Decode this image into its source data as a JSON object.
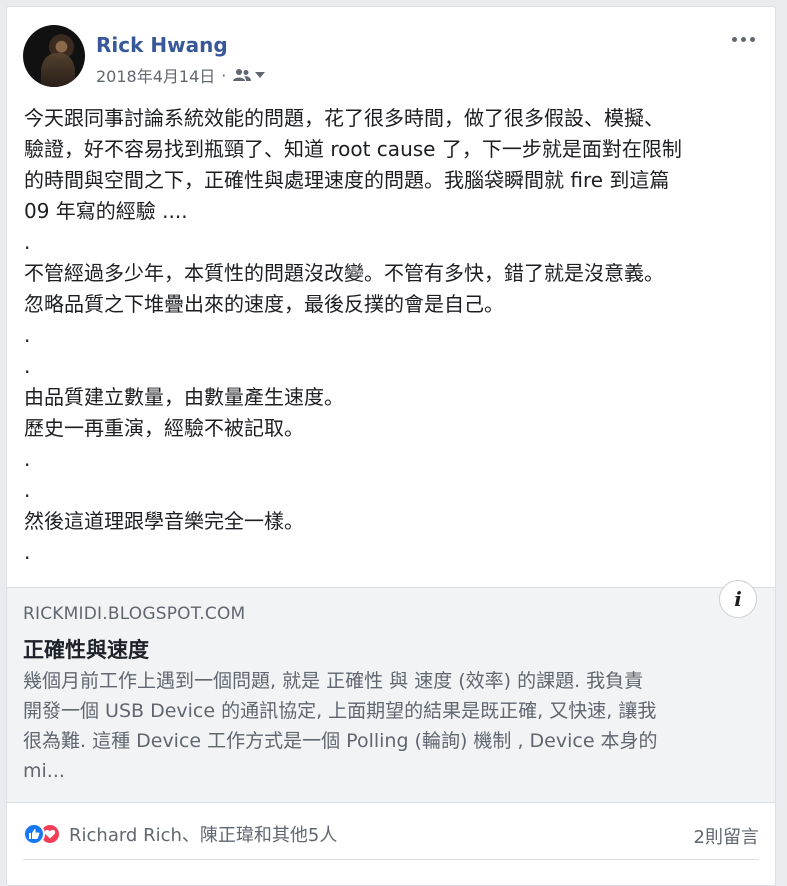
{
  "post": {
    "author": "Rick Hwang",
    "date": "2018年4月14日",
    "date_separator": "·",
    "audience_icon": "friends-icon",
    "more_icon": "more-options-icon",
    "body_lines": [
      "今天跟同事討論系統效能的問題，花了很多時間，做了很多假設、模擬、",
      "驗證，好不容易找到瓶頸了、知道 root cause 了，下一步就是面對在限制",
      "的時間與空間之下，正確性與處理速度的問題。我腦袋瞬間就 fire 到這篇",
      "09 年寫的經驗 ....",
      ".",
      "不管經過多少年，本質性的問題沒改變。不管有多快，錯了就是沒意義。",
      "忽略品質之下堆疊出來的速度，最後反撲的會是自己。",
      ".",
      ".",
      "由品質建立數量，由數量產生速度。",
      "歷史一再重演，經驗不被記取。",
      ".",
      ".",
      "然後這道理跟學音樂完全一樣。",
      "."
    ]
  },
  "link_preview": {
    "domain": "RICKMIDI.BLOGSPOT.COM",
    "title": "正確性與速度",
    "info_label": "i",
    "description_lines": [
      "幾個月前工作上遇到一個問題, 就是 正確性 與 速度 (效率) 的課題. 我負責",
      "開發一個 USB Device 的通訊協定, 上面期望的結果是既正確, 又快速, 讓我",
      "很為難. 這種 Device 工作方式是一個 Polling (輪詢) 機制 , Device 本身的",
      "mi..."
    ]
  },
  "footer": {
    "reaction_names": "Richard Rich、陳正瑋和其他5人",
    "comment_count": "2則留言",
    "reaction_icons": [
      "like-icon",
      "love-icon"
    ]
  },
  "colors": {
    "author": "#385898",
    "like": "#1877f2",
    "love": "#f33e58",
    "muted": "#606770"
  }
}
